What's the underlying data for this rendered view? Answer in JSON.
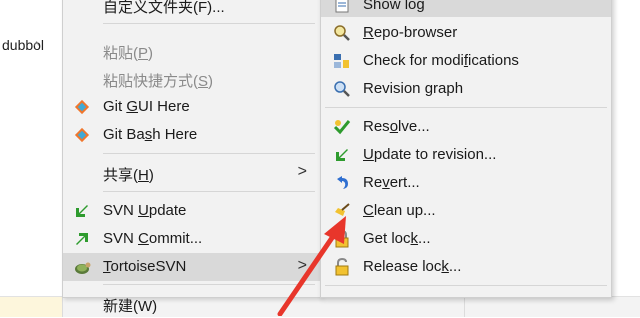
{
  "background": {
    "folder_fragment": "dubbol",
    "chevron": "^"
  },
  "left_menu": {
    "items": [
      {
        "label": "自定义文件夹(F)...",
        "state": "normal"
      },
      {
        "label_pre": "粘贴(",
        "label_key": "P",
        "label_post": ")",
        "state": "disabled"
      },
      {
        "label_pre": "粘贴快捷方式(",
        "label_key": "S",
        "label_post": ")",
        "state": "disabled"
      },
      {
        "label_pre": "Git ",
        "label_key": "G",
        "label_post": "UI Here",
        "icon": "git-gui-icon"
      },
      {
        "label_pre": "Git Ba",
        "label_key": "s",
        "label_post": "h Here",
        "icon": "git-bash-icon"
      },
      {
        "label_pre": "共享(",
        "label_key": "H",
        "label_post": ")",
        "submenu": true
      },
      {
        "label_pre": "SVN ",
        "label_key": "U",
        "label_post": "pdate",
        "icon": "svn-update-icon"
      },
      {
        "label_pre": "SVN ",
        "label_key": "C",
        "label_post": "ommit...",
        "icon": "svn-commit-icon"
      },
      {
        "label_pre": "",
        "label_key": "T",
        "label_post": "ortoiseSVN",
        "icon": "tortoisesvn-icon",
        "submenu": true,
        "highlighted": true
      },
      {
        "label": "新建(W)",
        "state": "normal"
      }
    ],
    "arrow_glyph": ">"
  },
  "right_menu": {
    "items": [
      {
        "label": "Show log",
        "icon": "show-log-icon",
        "highlighted": true
      },
      {
        "label_pre": "",
        "label_key": "R",
        "label_post": "epo-browser",
        "icon": "repo-browser-icon"
      },
      {
        "label_pre": "Check for modi",
        "label_key": "f",
        "label_post": "ications",
        "icon": "check-modifications-icon"
      },
      {
        "label_pre": "Revision ",
        "label_key": "g",
        "label_post": "raph",
        "icon": "revision-graph-icon"
      },
      {
        "label_pre": "Res",
        "label_key": "o",
        "label_post": "lve...",
        "icon": "resolve-icon"
      },
      {
        "label_pre": "",
        "label_key": "U",
        "label_post": "pdate to revision...",
        "icon": "update-revision-icon"
      },
      {
        "label_pre": "Re",
        "label_key": "v",
        "label_post": "ert...",
        "icon": "revert-icon"
      },
      {
        "label_pre": "",
        "label_key": "C",
        "label_post": "lean up...",
        "icon": "cleanup-icon"
      },
      {
        "label_pre": "Get loc",
        "label_key": "k",
        "label_post": "...",
        "icon": "lock-icon"
      },
      {
        "label_pre": "Release loc",
        "label_key": "k",
        "label_post": "...",
        "icon": "release-lock-icon"
      }
    ]
  },
  "colors": {
    "menu_bg": "#f2f2f2",
    "highlight": "#d9d9d9",
    "arrow_red": "#e8362b"
  }
}
